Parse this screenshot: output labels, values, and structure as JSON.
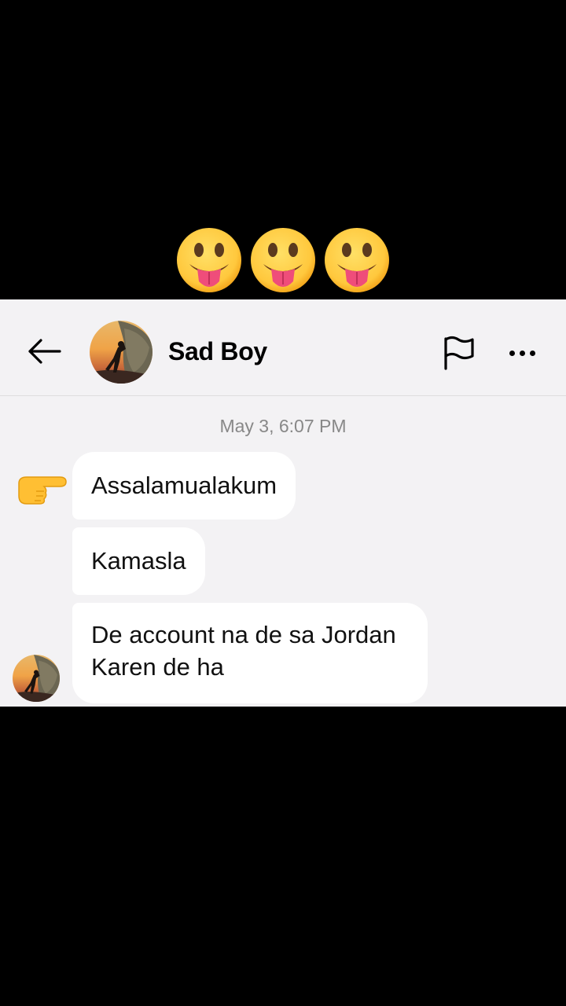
{
  "overlay": {
    "emojis": [
      {
        "icon": "tongue-out-face-icon",
        "color": "#ffc83d"
      },
      {
        "icon": "tongue-out-face-icon",
        "color": "#ffc83d"
      },
      {
        "icon": "tongue-out-face-icon",
        "color": "#ffc83d"
      }
    ]
  },
  "header": {
    "back_icon": "arrow-left-icon",
    "contact_name": "Sad Boy",
    "report_icon": "flag-icon",
    "more_icon": "more-horizontal-icon"
  },
  "conversation": {
    "timestamp": "May 3, 6:07 PM",
    "pointer_icon": "pointing-right-hand-icon",
    "messages": [
      {
        "text": "Assalamualakum"
      },
      {
        "text": "Kamasla"
      },
      {
        "text": "De account na de sa Jordan Karen de ha"
      }
    ]
  },
  "colors": {
    "background": "#000000",
    "chat_background": "#f3f2f4",
    "bubble": "#ffffff",
    "timestamp": "#888888"
  }
}
